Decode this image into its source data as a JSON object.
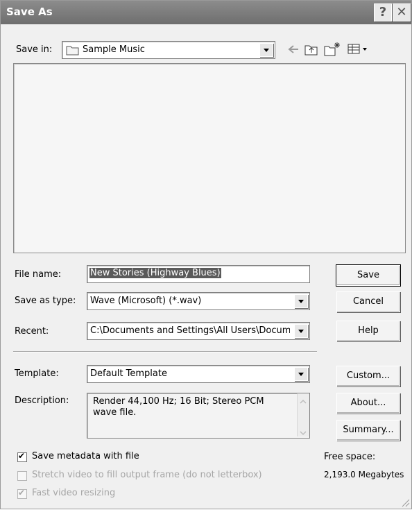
{
  "window": {
    "title": "Save As"
  },
  "titlebar_buttons": {
    "help": "?",
    "close": "✕"
  },
  "save_in": {
    "label": "Save in:",
    "value": "Sample Music"
  },
  "file_name": {
    "label": "File name:",
    "value": "New Stories (Highway Blues)"
  },
  "save_as_type": {
    "label": "Save as type:",
    "value": "Wave (Microsoft) (*.wav)"
  },
  "recent": {
    "label": "Recent:",
    "value": "C:\\Documents and Settings\\All Users\\Docum"
  },
  "template": {
    "label": "Template:",
    "value": "Default Template"
  },
  "description": {
    "label": "Description:",
    "value": "Render 44,100 Hz; 16 Bit; Stereo PCM wave file."
  },
  "buttons": {
    "save": "Save",
    "cancel": "Cancel",
    "help": "Help",
    "custom": "Custom...",
    "about": "About...",
    "summary": "Summary..."
  },
  "options": {
    "save_metadata": "Save metadata with file",
    "stretch_video": "Stretch video to fill output frame (do not letterbox)",
    "fast_resizing": "Fast video resizing"
  },
  "checkmarks": {
    "save_metadata": "✔",
    "fast_resizing": "✔"
  },
  "free_space": {
    "label": "Free space:",
    "value": "2,193.0 Megabytes"
  }
}
